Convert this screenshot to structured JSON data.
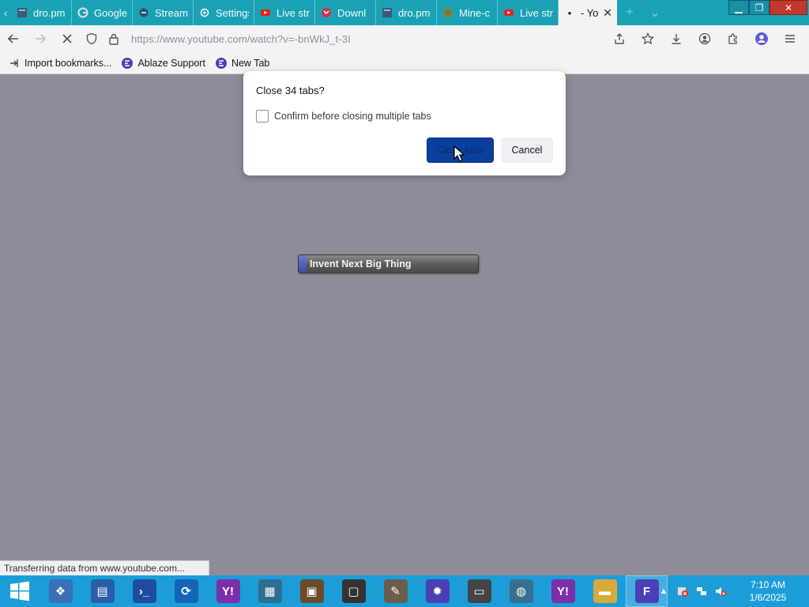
{
  "colors": {
    "tabstrip": "#1ba1b5",
    "toolbar": "#f3f3f5",
    "content_bg": "#8e8c99",
    "primary_button": "#0a3f9e",
    "taskbar": "#1d9dd8",
    "close_button": "#c0392b"
  },
  "tabs": [
    {
      "label": "dro.pm",
      "icon": "document-icon"
    },
    {
      "label": "Google",
      "icon": "google-icon"
    },
    {
      "label": "Stream",
      "icon": "stream-icon"
    },
    {
      "label": "Settings",
      "icon": "gear-icon"
    },
    {
      "label": "Live str",
      "icon": "youtube-icon"
    },
    {
      "label": "Downl",
      "icon": "download-site-icon"
    },
    {
      "label": "dro.pm",
      "icon": "document-icon"
    },
    {
      "label": "Mine-c",
      "icon": "minecraft-icon"
    },
    {
      "label": "Live str",
      "icon": "youtube-icon"
    }
  ],
  "active_tab": {
    "label": "- Yo",
    "close_glyph": "✕"
  },
  "window_controls": {
    "minimize": "▁",
    "restore": "❐",
    "close": "✕"
  },
  "nav": {
    "url": "https://www.youtube.com/watch?v=-bnWkJ_t-3I"
  },
  "bookmarks": [
    {
      "label": "Import bookmarks...",
      "icon": "import-icon"
    },
    {
      "label": "Ablaze Support",
      "icon": "ablaze-icon"
    },
    {
      "label": "New Tab",
      "icon": "ablaze-icon"
    }
  ],
  "dialog": {
    "title": "Close 34 tabs?",
    "checkbox_label": "Confirm before closing multiple tabs",
    "checkbox_checked": false,
    "primary_button": "Close tabs",
    "cancel_button": "Cancel"
  },
  "page": {
    "invent_label": "Invent Next Big Thing"
  },
  "status_text": "Transferring data from www.youtube.com...",
  "taskbar": {
    "apps": [
      {
        "name": "windows-explorer-icon"
      },
      {
        "name": "remote-desktop-icon"
      },
      {
        "name": "powershell-icon"
      },
      {
        "name": "sync-icon"
      },
      {
        "name": "yahoo-messenger-icon"
      },
      {
        "name": "notepad-icon"
      },
      {
        "name": "minecraft-icon"
      },
      {
        "name": "photo-viewer-icon"
      },
      {
        "name": "gimp-icon"
      },
      {
        "name": "virus-icon"
      },
      {
        "name": "monitor-icon"
      },
      {
        "name": "globe-icon"
      },
      {
        "name": "yahoo-icon"
      },
      {
        "name": "file-explorer-icon"
      },
      {
        "name": "ablaze-browser-icon"
      }
    ],
    "clock_time": "7:10 AM",
    "clock_date": "1/6/2025"
  }
}
